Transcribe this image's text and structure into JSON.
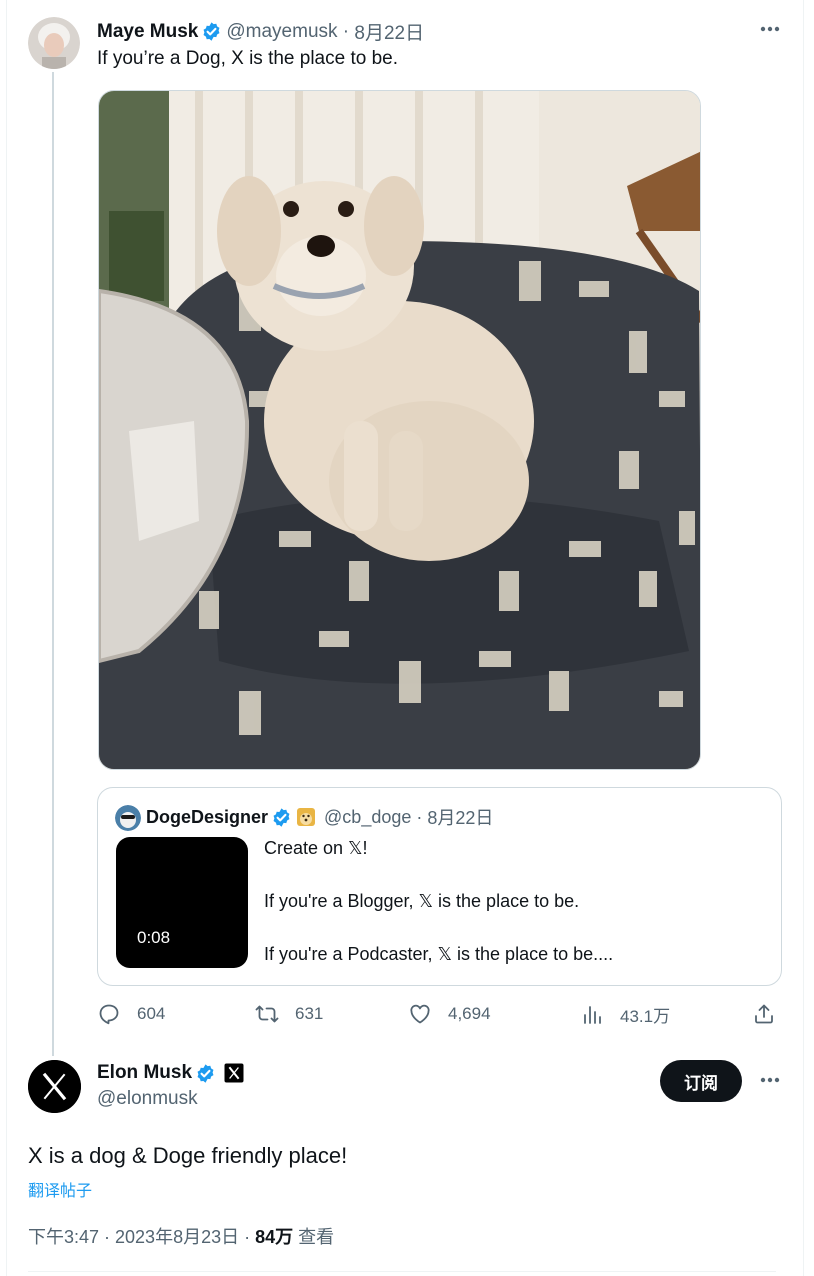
{
  "parent_tweet": {
    "name": "Maye Musk",
    "handle": "@mayemusk",
    "date": "8月22日",
    "text": "If you’re a Dog, X is the place to be."
  },
  "quoted_tweet": {
    "name": "DogeDesigner",
    "handle": "@cb_doge",
    "date": "8月22日",
    "video_duration": "0:08",
    "lines": [
      "Create on 𝕏!",
      "If you're a Blogger, 𝕏 is the place to be.",
      "If you're a Podcaster, 𝕏 is the place to be...."
    ]
  },
  "actions": {
    "replies": "604",
    "retweets": "631",
    "likes": "4,694",
    "views": "43.1万"
  },
  "main_tweet": {
    "name": "Elon Musk",
    "handle": "@elonmusk",
    "subscribe_label": "订阅",
    "text": "X is a dog & Doge friendly place!",
    "translate_label": "翻译帖子",
    "time": "下午3:47 · 2023年8月23日 · ",
    "views_count": "84万",
    "views_label": " 查看"
  },
  "colors": {
    "accent": "#1d9bf0",
    "text": "#0f1419",
    "muted": "#536471",
    "border": "#cfd9de"
  },
  "icons": [
    "more-icon",
    "verified-icon",
    "reply-icon",
    "retweet-icon",
    "like-icon",
    "views-icon",
    "share-icon",
    "x-logo-icon",
    "doge-emoji-icon"
  ]
}
